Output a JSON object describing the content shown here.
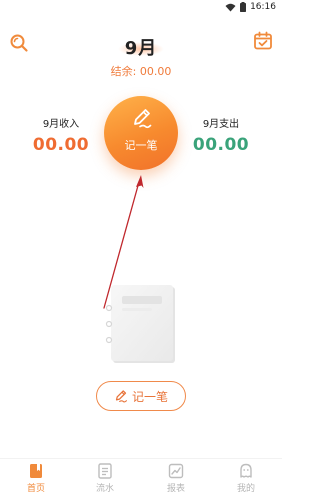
{
  "status_bar": {
    "time": "16:16"
  },
  "header": {
    "month": "9月",
    "balance_label": "结余: 00.00"
  },
  "summary": {
    "income_label": "9月收入",
    "income_value": "00.00",
    "expense_label": "9月支出",
    "expense_value": "00.00"
  },
  "record_circle": {
    "label": "记一笔"
  },
  "record_button": {
    "label": "记一笔"
  },
  "tabs": [
    {
      "label": "首页",
      "icon": "book-icon",
      "active": true
    },
    {
      "label": "流水",
      "icon": "list-icon",
      "active": false
    },
    {
      "label": "报表",
      "icon": "chart-icon",
      "active": false
    },
    {
      "label": "我的",
      "icon": "profile-icon",
      "active": false
    }
  ],
  "colors": {
    "accent": "#f78a2e",
    "income": "#ef6c32",
    "expense": "#3aa37a",
    "arrow": "#c0282d"
  }
}
